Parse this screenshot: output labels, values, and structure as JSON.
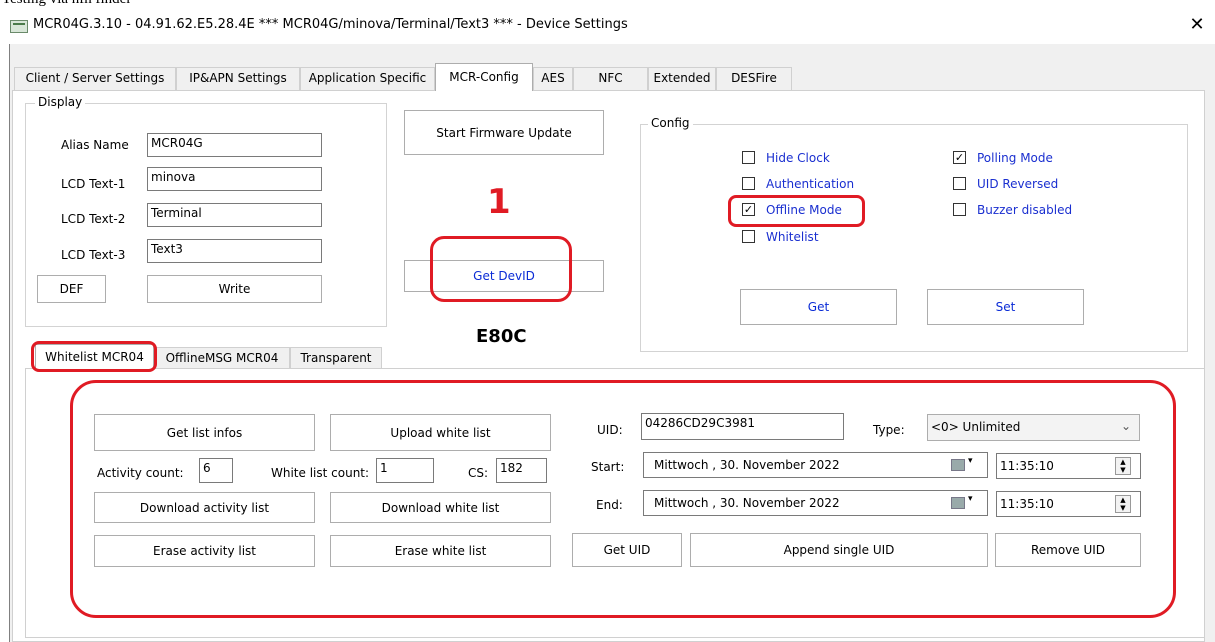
{
  "caption": "Testing via nfh finder",
  "window": {
    "title": "MCR04G.3.10 - 04.91.62.E5.28.4E *** MCR04G/minova/Terminal/Text3 *** - Device Settings",
    "close_icon": "close-icon",
    "app_icon": "app-window-icon"
  },
  "tabs": [
    {
      "label": "Client / Server Settings"
    },
    {
      "label": "IP&APN Settings"
    },
    {
      "label": "Application Specific"
    },
    {
      "label": "MCR-Config"
    },
    {
      "label": "AES"
    },
    {
      "label": "NFC"
    },
    {
      "label": "Extended"
    },
    {
      "label": "DESFire"
    }
  ],
  "display": {
    "legend": "Display",
    "alias_label": "Alias Name",
    "alias_value": "MCR04G",
    "lcd1_label": "LCD Text-1",
    "lcd1_value": "minova",
    "lcd2_label": "LCD Text-2",
    "lcd2_value": "Terminal",
    "lcd3_label": "LCD Text-3",
    "lcd3_value": "Text3",
    "def_button": "DEF",
    "write_button": "Write"
  },
  "center": {
    "firmware_button": "Start Firmware Update",
    "annotation_number": "1",
    "get_devid_button": "Get DevID",
    "devid_value": "E80C"
  },
  "config": {
    "legend": "Config",
    "options": {
      "hide_clock": {
        "label": "Hide Clock",
        "checked": false
      },
      "authentication": {
        "label": "Authentication",
        "checked": false
      },
      "offline_mode": {
        "label": "Offline Mode",
        "checked": true
      },
      "whitelist": {
        "label": "Whitelist",
        "checked": false
      },
      "polling_mode": {
        "label": "Polling Mode",
        "checked": true
      },
      "uid_reversed": {
        "label": "UID Reversed",
        "checked": false
      },
      "buzzer_disabled": {
        "label": "Buzzer disabled",
        "checked": false
      }
    },
    "check_mark": "✓",
    "get_button": "Get",
    "set_button": "Set"
  },
  "sub_tabs": [
    {
      "label": "Whitelist MCR04"
    },
    {
      "label": "OfflineMSG MCR04"
    },
    {
      "label": "Transparent"
    }
  ],
  "whitelist": {
    "get_list_infos": "Get list infos",
    "upload_white_list": "Upload white list",
    "activity_count_label": "Activity count:",
    "activity_count_value": "6",
    "white_list_count_label": "White list count:",
    "white_list_count_value": "1",
    "cs_label": "CS:",
    "cs_value": "182",
    "download_activity_list": "Download activity list",
    "download_white_list": "Download white list",
    "erase_activity_list": "Erase activity list",
    "erase_white_list": "Erase white list",
    "get_uid": "Get UID",
    "append_single_uid": "Append single UID",
    "remove_uid": "Remove UID",
    "uid_label": "UID:",
    "uid_value": "04286CD29C3981",
    "type_label": "Type:",
    "type_value": "<0> Unlimited",
    "start_label": "Start:",
    "start_date": "Mittwoch  , 30. November  2022",
    "start_time": "11:35:10",
    "end_label": "End:",
    "end_date": "Mittwoch  , 30. November  2022",
    "end_time": "11:35:10"
  },
  "colors": {
    "annotation_red": "#e01b24",
    "checkbox_label_blue": "#1a2fd0",
    "button_text_blue": "#0a2bd6"
  }
}
